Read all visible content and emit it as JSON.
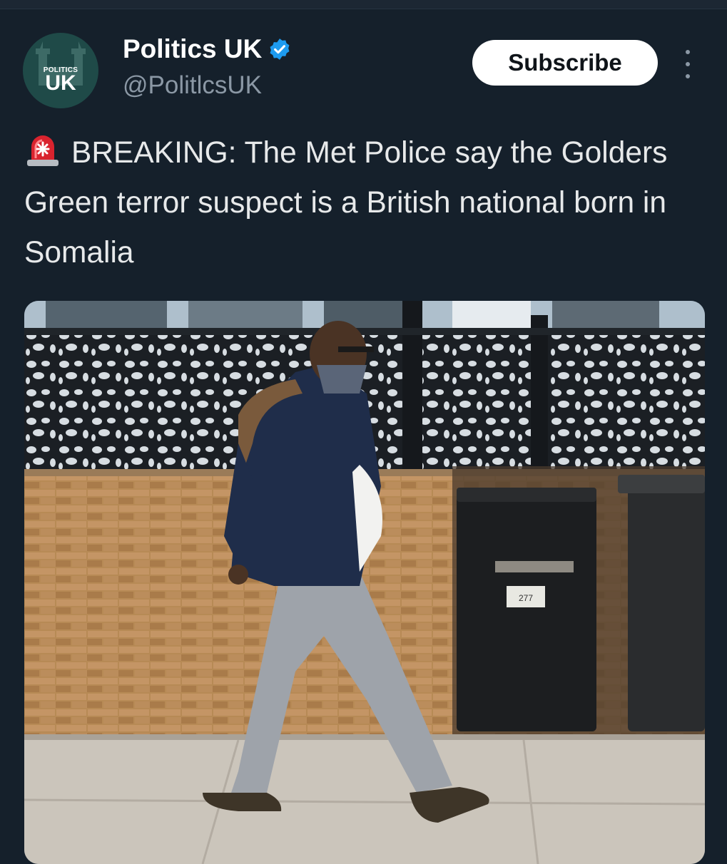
{
  "account": {
    "display_name": "Politics UK",
    "handle": "@PolitlcsUK",
    "avatar_small_text": "POLITICS",
    "avatar_big_text": "UK",
    "verified": true
  },
  "actions": {
    "subscribe_label": "Subscribe",
    "more_icon": "more-vertical-icon"
  },
  "tweet": {
    "emoji": "police-siren-icon",
    "text": "BREAKING: The Met Police say the Golders Green terror suspect is a British national born in Somalia"
  },
  "bin_label": "277",
  "colors": {
    "background": "#15202b",
    "handle": "#8b98a5",
    "verified_badge": "#1d9bf0",
    "subscribe_bg": "#ffffff",
    "avatar_bg": "#1f4a48",
    "siren_red": "#d9232e"
  }
}
